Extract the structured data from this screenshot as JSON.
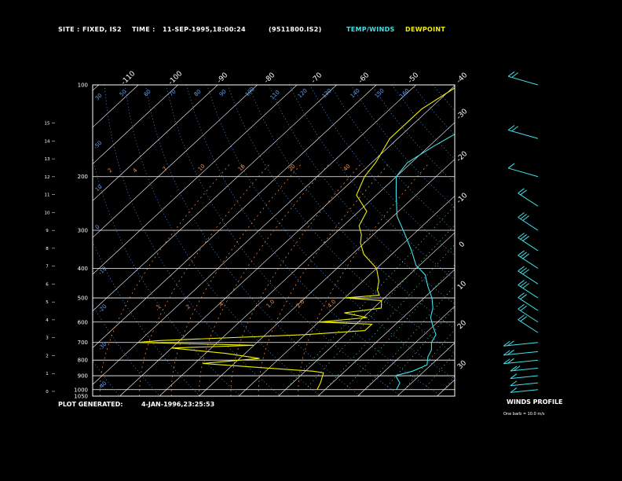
{
  "header": {
    "site_label": "SITE :",
    "site_value": "FIXED, IS2",
    "time_label": "TIME :",
    "time_value": "11-SEP-1995,18:00:24",
    "file_id": "(9511800.IS2)",
    "temp_winds": "TEMP/WINDS",
    "dewpoint": "DEWPOINT"
  },
  "footer": {
    "plot_generated_label": "PLOT GENERATED:",
    "plot_generated_value": "4-JAN-1996,23:25:53"
  },
  "wind_profile": {
    "title": "WINDS PROFILE",
    "legend": "One barb = 10.0 m/s"
  },
  "colors": {
    "temperature": "#40e0e8",
    "dewpoint": "#f0f000",
    "isotherm_label": "#a0a0a0",
    "mixing_ratio": "#ff9040",
    "dry_adiabat": "#60a0ff",
    "moist_adiabat": "#80ffa0"
  },
  "chart_data": {
    "type": "line",
    "title": "",
    "pressure_ticks": [
      100,
      200,
      300,
      400,
      500,
      600,
      700,
      800,
      900,
      1000,
      1050
    ],
    "height_ticks_km": [
      0,
      1,
      2,
      3,
      4,
      5,
      6,
      7,
      8,
      9,
      10,
      11,
      12,
      13,
      14,
      15
    ],
    "isotherm_labels_c": [
      -110,
      -100,
      -90,
      -80,
      -70,
      -60,
      -50,
      -40,
      -30,
      -20,
      -10,
      0,
      10,
      20,
      30
    ],
    "mixing_ratio_labels": [
      "2",
      "4",
      "7",
      "10",
      "16",
      "20",
      "40",
      ".1",
      ".2",
      ".4",
      "1.0",
      "2.0",
      "4.0"
    ],
    "dry_adiabat_labels": [
      "30",
      "50",
      "60",
      "70",
      "80",
      "90",
      "100",
      "110",
      "120",
      "130",
      "140",
      "150",
      "160",
      "10",
      "0",
      "-10",
      "-20",
      "-30",
      "-40",
      "-50"
    ],
    "series": [
      {
        "name": "TEMP/WINDS",
        "points": [
          [
            -34,
            100
          ],
          [
            -35.5,
            120
          ],
          [
            -36,
            140
          ],
          [
            -39,
            160
          ],
          [
            -41,
            180
          ],
          [
            -40,
            200
          ],
          [
            -35,
            230
          ],
          [
            -29,
            270
          ],
          [
            -22,
            310
          ],
          [
            -16,
            350
          ],
          [
            -11,
            390
          ],
          [
            -6,
            420
          ],
          [
            -2,
            460
          ],
          [
            2,
            500
          ],
          [
            5,
            540
          ],
          [
            7,
            580
          ],
          [
            10,
            620
          ],
          [
            13,
            660
          ],
          [
            14,
            700
          ],
          [
            16,
            740
          ],
          [
            17,
            780
          ],
          [
            19,
            830
          ],
          [
            17,
            870
          ],
          [
            14,
            900
          ],
          [
            17,
            950
          ],
          [
            18,
            1000
          ]
        ]
      },
      {
        "name": "DEWPOINT",
        "points": [
          [
            -49,
            100
          ],
          [
            -52,
            120
          ],
          [
            -52,
            150
          ],
          [
            -49,
            180
          ],
          [
            -48,
            200
          ],
          [
            -45,
            230
          ],
          [
            -38,
            260
          ],
          [
            -36,
            290
          ],
          [
            -33,
            310
          ],
          [
            -31,
            330
          ],
          [
            -27,
            360
          ],
          [
            -20,
            400
          ],
          [
            -16,
            440
          ],
          [
            -14,
            470
          ],
          [
            -12,
            490
          ],
          [
            -20,
            500
          ],
          [
            -10,
            510
          ],
          [
            -8,
            540
          ],
          [
            -16,
            560
          ],
          [
            -9,
            580
          ],
          [
            -20,
            600
          ],
          [
            -6,
            610
          ],
          [
            -6,
            640
          ],
          [
            -20,
            660
          ],
          [
            -55,
            690
          ],
          [
            -60,
            700
          ],
          [
            -30,
            715
          ],
          [
            -50,
            730
          ],
          [
            -35,
            760
          ],
          [
            -25,
            790
          ],
          [
            -38,
            820
          ],
          [
            -20,
            850
          ],
          [
            -8,
            870
          ],
          [
            -5,
            880
          ],
          [
            -3,
            950
          ],
          [
            -2,
            1000
          ]
        ]
      }
    ],
    "winds": [
      {
        "p": 100,
        "barbs": 2
      },
      {
        "p": 150,
        "barbs": 2
      },
      {
        "p": 200,
        "barbs": 1
      },
      {
        "p": 250,
        "barbs": 2
      },
      {
        "p": 300,
        "barbs": 3
      },
      {
        "p": 350,
        "barbs": 3
      },
      {
        "p": 400,
        "barbs": 3
      },
      {
        "p": 450,
        "barbs": 3
      },
      {
        "p": 500,
        "barbs": 3
      },
      {
        "p": 550,
        "barbs": 2
      },
      {
        "p": 600,
        "barbs": 2
      },
      {
        "p": 650,
        "barbs": 2
      },
      {
        "p": 700,
        "barbs": 2
      },
      {
        "p": 750,
        "barbs": 2
      },
      {
        "p": 800,
        "barbs": 2
      },
      {
        "p": 850,
        "barbs": 2
      },
      {
        "p": 900,
        "barbs": 1
      },
      {
        "p": 950,
        "barbs": 1
      },
      {
        "p": 1000,
        "barbs": 1
      }
    ]
  }
}
